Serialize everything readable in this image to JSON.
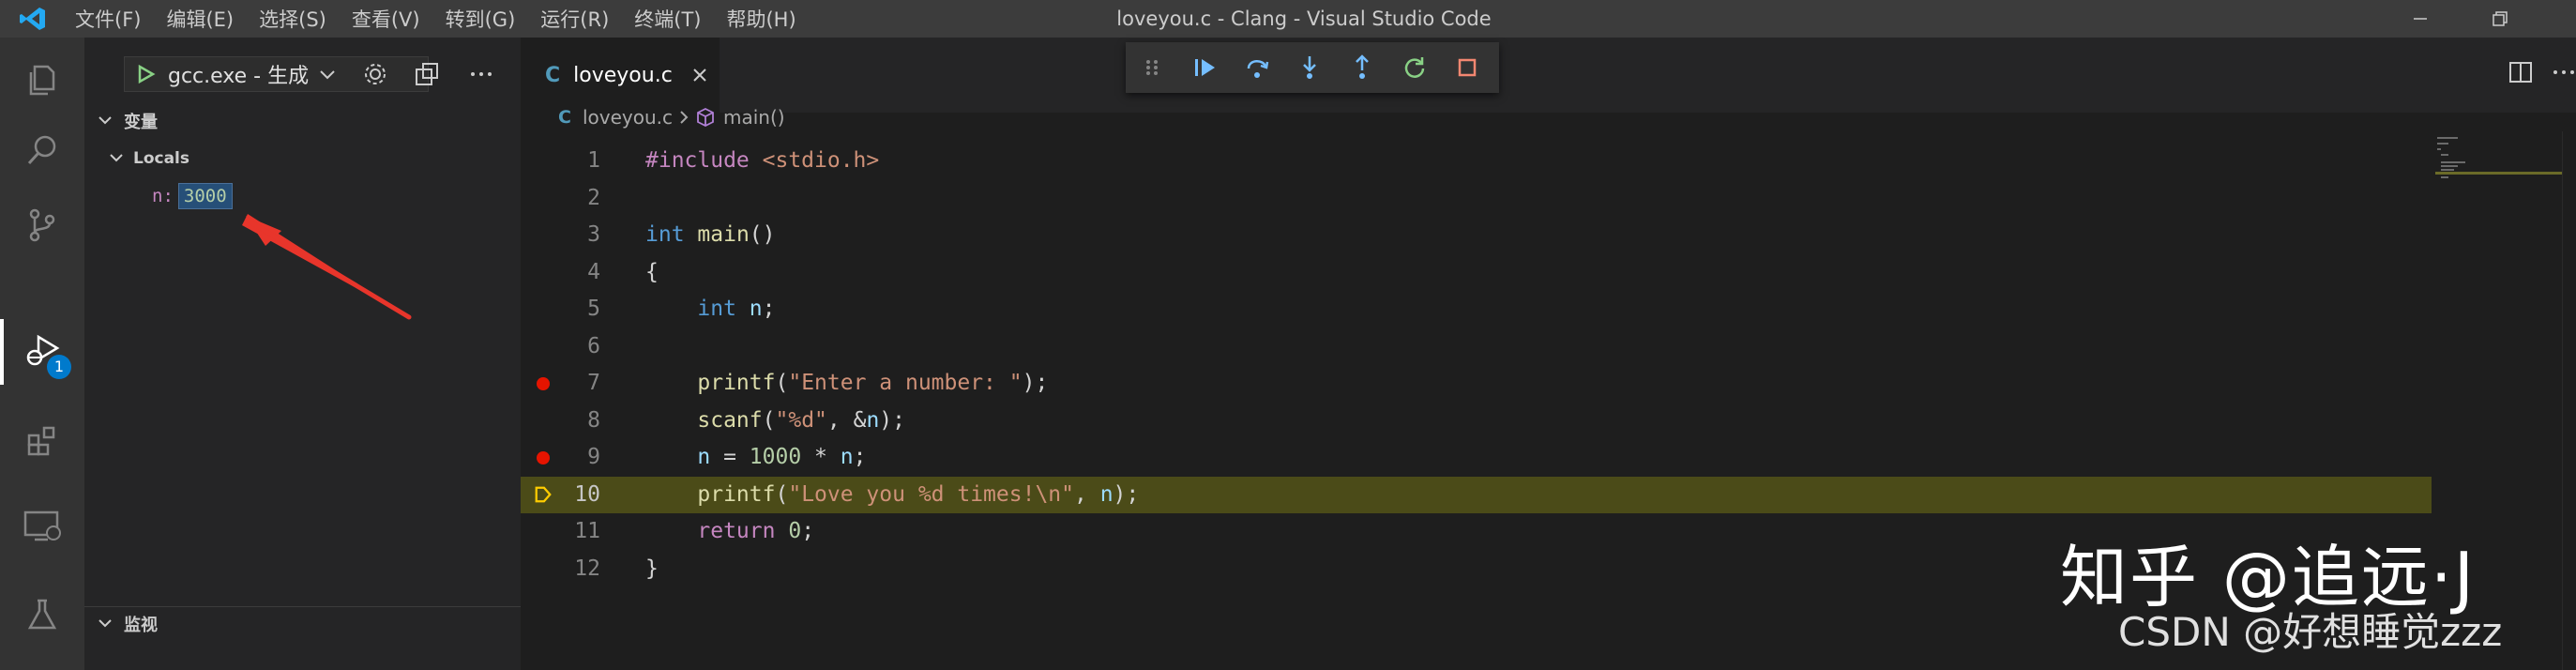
{
  "app": {
    "window_title": "loveyou.c - Clang - Visual Studio Code",
    "accent": "#007acc"
  },
  "menu": [
    "文件(F)",
    "编辑(E)",
    "选择(S)",
    "查看(V)",
    "转到(G)",
    "运行(R)",
    "终端(T)",
    "帮助(H)"
  ],
  "activity_bar": {
    "items": [
      "files-icon",
      "search-icon",
      "source-control-icon",
      "run-debug-icon",
      "extensions-icon",
      "remote-explorer-icon",
      "testing-icon"
    ],
    "debug_badge": "1"
  },
  "sidebar": {
    "launch_config": "gcc.exe - 生成",
    "variables_title": "变量",
    "locals_title": "Locals",
    "locals": [
      {
        "name": "n:",
        "value": "3000"
      }
    ],
    "watch_title": "监视"
  },
  "editor": {
    "tab_glyph": "C",
    "tab_label": "loveyou.c",
    "breadcrumb": {
      "file": "loveyou.c",
      "symbol": "main()"
    },
    "current_line": 10,
    "breakpoints": [
      7,
      9
    ],
    "lines": [
      {
        "n": "1",
        "tokens": [
          {
            "t": "#include ",
            "c": "pp"
          },
          {
            "t": "<stdio.h>",
            "c": "str"
          }
        ]
      },
      {
        "n": "2",
        "tokens": []
      },
      {
        "n": "3",
        "tokens": [
          {
            "t": "int",
            "c": "kw"
          },
          {
            "t": " ",
            "c": ""
          },
          {
            "t": "main",
            "c": "fn"
          },
          {
            "t": "()",
            "c": ""
          }
        ]
      },
      {
        "n": "4",
        "tokens": [
          {
            "t": "{",
            "c": ""
          }
        ]
      },
      {
        "n": "5",
        "tokens": [
          {
            "t": "    ",
            "c": ""
          },
          {
            "t": "int",
            "c": "kw"
          },
          {
            "t": " ",
            "c": ""
          },
          {
            "t": "n",
            "c": "var"
          },
          {
            "t": ";",
            "c": ""
          }
        ]
      },
      {
        "n": "6",
        "tokens": []
      },
      {
        "n": "7",
        "tokens": [
          {
            "t": "    ",
            "c": ""
          },
          {
            "t": "printf",
            "c": "fn"
          },
          {
            "t": "(",
            "c": ""
          },
          {
            "t": "\"Enter a number: \"",
            "c": "str"
          },
          {
            "t": ");",
            "c": ""
          }
        ]
      },
      {
        "n": "8",
        "tokens": [
          {
            "t": "    ",
            "c": ""
          },
          {
            "t": "scanf",
            "c": "fn"
          },
          {
            "t": "(",
            "c": ""
          },
          {
            "t": "\"%d\"",
            "c": "str"
          },
          {
            "t": ", &",
            "c": ""
          },
          {
            "t": "n",
            "c": "var"
          },
          {
            "t": ");",
            "c": ""
          }
        ]
      },
      {
        "n": "9",
        "tokens": [
          {
            "t": "    ",
            "c": ""
          },
          {
            "t": "n",
            "c": "var"
          },
          {
            "t": " = ",
            "c": ""
          },
          {
            "t": "1000",
            "c": "num"
          },
          {
            "t": " * ",
            "c": ""
          },
          {
            "t": "n",
            "c": "var"
          },
          {
            "t": ";",
            "c": ""
          }
        ]
      },
      {
        "n": "10",
        "tokens": [
          {
            "t": "    ",
            "c": ""
          },
          {
            "t": "printf",
            "c": "fn"
          },
          {
            "t": "(",
            "c": ""
          },
          {
            "t": "\"Love you %d times!\\n\"",
            "c": "str"
          },
          {
            "t": ", ",
            "c": ""
          },
          {
            "t": "n",
            "c": "var"
          },
          {
            "t": ");",
            "c": ""
          }
        ]
      },
      {
        "n": "11",
        "tokens": [
          {
            "t": "    ",
            "c": ""
          },
          {
            "t": "return",
            "c": "ctl"
          },
          {
            "t": " ",
            "c": ""
          },
          {
            "t": "0",
            "c": "num"
          },
          {
            "t": ";",
            "c": ""
          }
        ]
      },
      {
        "n": "12",
        "tokens": [
          {
            "t": "}",
            "c": ""
          }
        ]
      }
    ]
  },
  "debug_toolbar": [
    "drag-handle-icon",
    "continue-icon",
    "step-over-icon",
    "step-into-icon",
    "step-out-icon",
    "restart-icon",
    "stop-icon"
  ],
  "watermarks": {
    "zhihu": "知乎 @追远·J",
    "csdn": "CSDN @好想睡觉zzz"
  }
}
